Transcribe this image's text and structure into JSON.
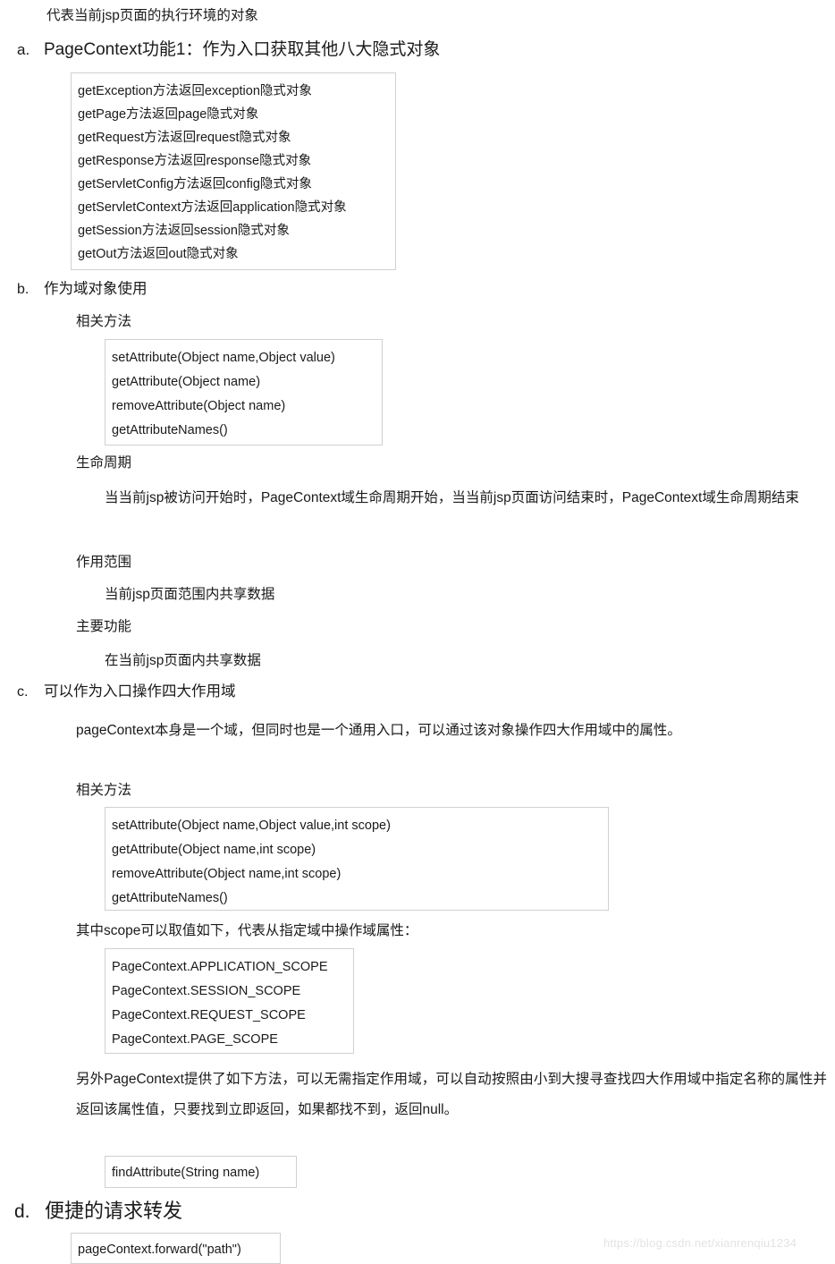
{
  "intro": {
    "text": "代表当前jsp页面的执行环境的对象"
  },
  "sections": {
    "a": {
      "marker": "a.",
      "heading": "PageContext功能1：作为入口获取其他八大隐式对象",
      "implicit_objects_box": [
        "getException方法返回exception隐式对象",
        "getPage方法返回page隐式对象",
        "getRequest方法返回request隐式对象",
        "getResponse方法返回response隐式对象",
        "getServletConfig方法返回config隐式对象",
        "getServletContext方法返回application隐式对象",
        "getSession方法返回session隐式对象",
        "getOut方法返回out隐式对象"
      ]
    },
    "b": {
      "marker": "b.",
      "heading": "作为域对象使用",
      "methods_label": "相关方法",
      "methods_box": [
        "setAttribute(Object name,Object value)",
        "getAttribute(Object name)",
        "removeAttribute(Object name)",
        "getAttributeNames()"
      ],
      "lifecycle_label": "生命周期",
      "lifecycle_text": "当当前jsp被访问开始时，PageContext域生命周期开始，当当前jsp页面访问结束时，PageContext域生命周期结束",
      "scope_label": "作用范围",
      "scope_text": "当前jsp页面范围内共享数据",
      "function_label": "主要功能",
      "function_text": "在当前jsp页面内共享数据"
    },
    "c": {
      "marker": "c.",
      "heading": "可以作为入口操作四大作用域",
      "paragraph": "pageContext本身是一个域，但同时也是一个通用入口，可以通过该对象操作四大作用域中的属性。",
      "methods_label": "相关方法",
      "methods_box": [
        "setAttribute(Object name,Object value,int scope)",
        "getAttribute(Object name,int scope)",
        "removeAttribute(Object name,int scope)",
        "getAttributeNames()"
      ],
      "scope_values_label": "其中scope可以取值如下，代表从指定域中操作域属性：",
      "scope_values_box": [
        "PageContext.APPLICATION_SCOPE",
        "PageContext.SESSION_SCOPE",
        "PageContext.REQUEST_SCOPE",
        "PageContext.PAGE_SCOPE"
      ],
      "find_paragraph": "另外PageContext提供了如下方法，可以无需指定作用域，可以自动按照由小到大搜寻查找四大作用域中指定名称的属性并返回该属性值，只要找到立即返回，如果都找不到，返回null。",
      "find_box": [
        "findAttribute(String name)"
      ]
    },
    "d": {
      "marker": "d.",
      "heading": "便捷的请求转发",
      "forward_box": [
        "pageContext.forward(\"path\")"
      ]
    }
  },
  "watermark": {
    "text": "https://blog.csdn.net/xianrenqiu1234"
  },
  "colors": {
    "text": "#1a1a1a",
    "box_border": "#d0d0d0",
    "background": "#ffffff",
    "watermark": "#e3e3e3"
  }
}
